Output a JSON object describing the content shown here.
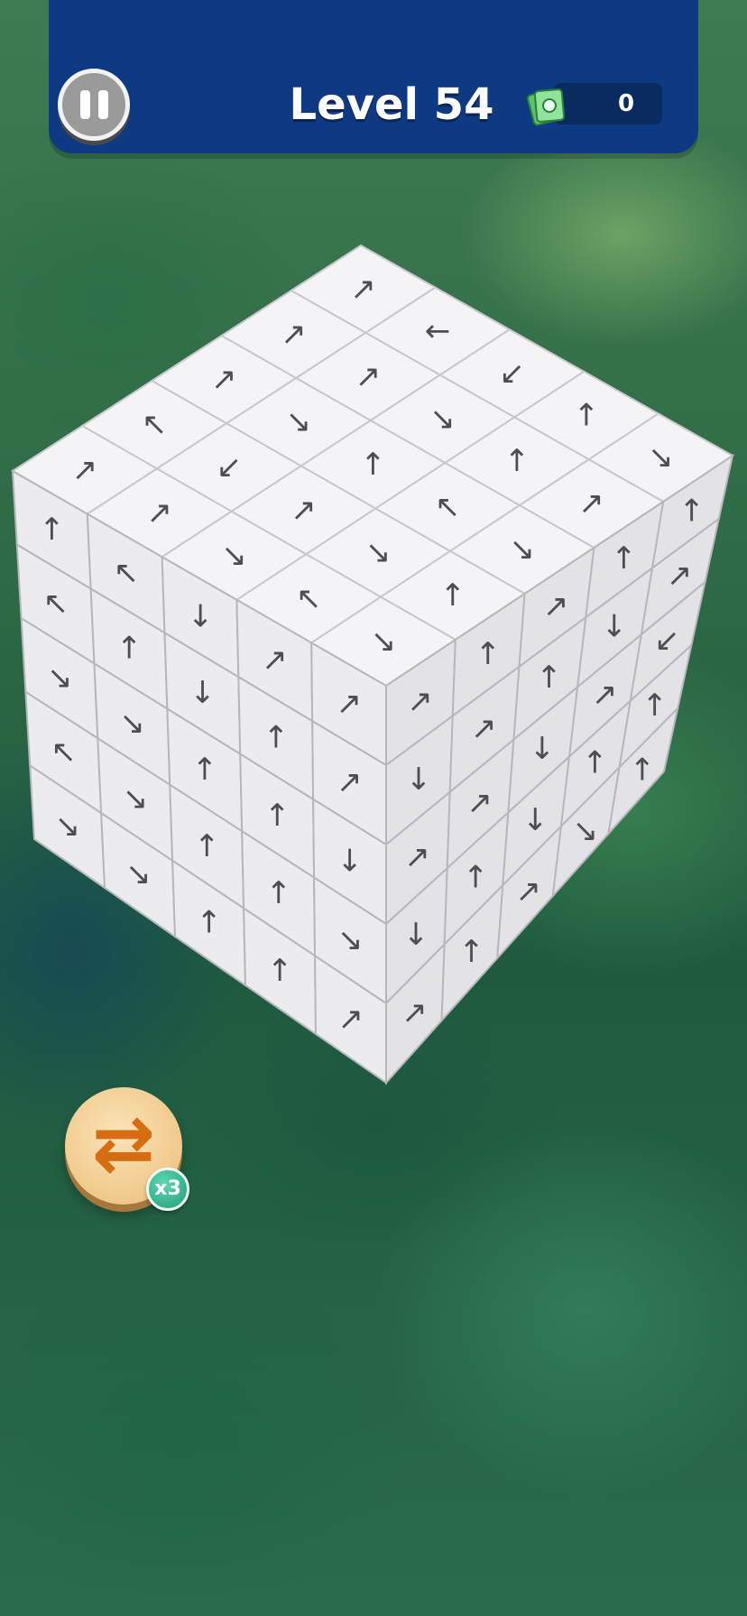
{
  "header": {
    "level_label": "Level 54",
    "cash_count": "0",
    "pause_icon": "pause-icon",
    "cash_icon": "cash-icon",
    "colors": {
      "bar": "#0d3a82",
      "cash_box": "#0a2b5f"
    }
  },
  "cube": {
    "grid_size": 5,
    "top_arrows": [
      [
        "↗",
        "←",
        "↙",
        "↑",
        "↘"
      ],
      [
        "↗",
        "↗",
        "↘",
        "↑",
        "↗"
      ],
      [
        "↗",
        "↘",
        "↑",
        "↖",
        "↘"
      ],
      [
        "↖",
        "↙",
        "↗",
        "↘",
        "↑"
      ],
      [
        "↗",
        "↗",
        "↘",
        "↖",
        "↘"
      ]
    ],
    "left_arrows": [
      [
        "↑",
        "↖",
        "↓",
        "↗",
        "↗"
      ],
      [
        "↖",
        "↑",
        "↓",
        "↑",
        "↗"
      ],
      [
        "↘",
        "↘",
        "↑",
        "↑",
        "↓"
      ],
      [
        "↖",
        "↘",
        "↑",
        "↑",
        "↘"
      ],
      [
        "↘",
        "↘",
        "↑",
        "↑",
        "↗"
      ]
    ],
    "right_arrows": [
      [
        "↗",
        "↑",
        "↗",
        "↑",
        "↑"
      ],
      [
        "↓",
        "↗",
        "↑",
        "↓",
        "↗"
      ],
      [
        "↗",
        "↗",
        "↓",
        "↗",
        "↙"
      ],
      [
        "↓",
        "↑",
        "↓",
        "↑",
        "↑"
      ],
      [
        "↗",
        "↑",
        "↗",
        "↘",
        "↑"
      ]
    ]
  },
  "powerup": {
    "icon": "swap-arrows-icon",
    "glyph": "⇄",
    "count_label": "x3"
  }
}
